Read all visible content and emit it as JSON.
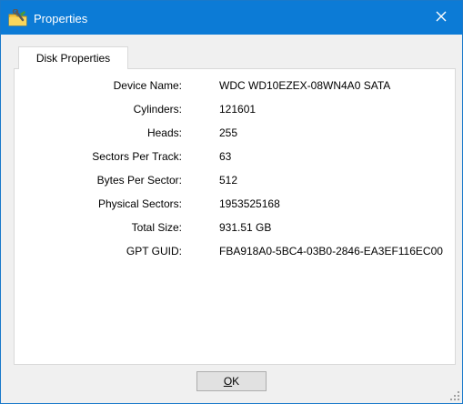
{
  "window": {
    "title": "Properties",
    "icons": {
      "app": "folder-wrench-icon",
      "close": "close-icon",
      "resize": "resize-grip-icon"
    }
  },
  "tabs": [
    {
      "label": "Disk Properties",
      "selected": true
    }
  ],
  "properties": [
    {
      "label": "Device Name:",
      "value": "WDC WD10EZEX-08WN4A0 SATA"
    },
    {
      "label": "Cylinders:",
      "value": "121601"
    },
    {
      "label": "Heads:",
      "value": "255"
    },
    {
      "label": "Sectors Per Track:",
      "value": "63"
    },
    {
      "label": "Bytes Per Sector:",
      "value": "512"
    },
    {
      "label": "Physical Sectors:",
      "value": "1953525168"
    },
    {
      "label": "Total Size:",
      "value": "931.51 GB"
    },
    {
      "label": "GPT GUID:",
      "value": "FBA918A0-5BC4-03B0-2846-EA3EF116EC00"
    }
  ],
  "buttons": {
    "ok_mnemonic": "O",
    "ok_rest": "K"
  },
  "colors": {
    "titlebar": "#0c7bd6",
    "window_border": "#1979ca",
    "panel_bg": "#ffffff",
    "dialog_bg": "#f0f0f0"
  }
}
